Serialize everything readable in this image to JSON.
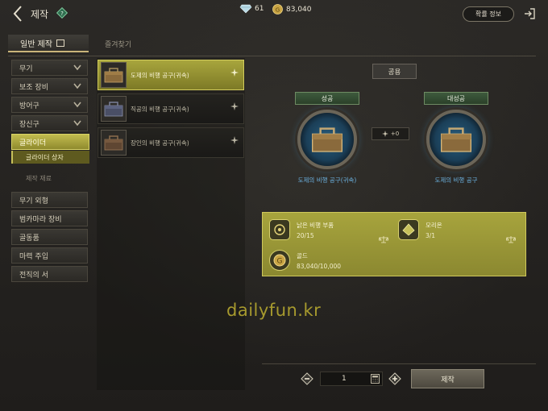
{
  "header": {
    "title": "제작",
    "crystal_count": "61",
    "gold_count": "83,040",
    "rate_info_label": "확률 정보"
  },
  "tabs": {
    "general": "일반 제작",
    "favorites": "즐겨찾기"
  },
  "categories": [
    {
      "label": "무기"
    },
    {
      "label": "보조 장비"
    },
    {
      "label": "방어구"
    },
    {
      "label": "장신구"
    }
  ],
  "active_category": "글라이더",
  "active_subcategory": "글라이더 상자",
  "section_label": "제작 재료",
  "sub_categories": [
    {
      "label": "무기 외형"
    },
    {
      "label": "범카마라 장비"
    },
    {
      "label": "골동품"
    },
    {
      "label": "마력 주입"
    },
    {
      "label": "전직의 서"
    }
  ],
  "items": [
    {
      "name": "도제의 비행 공구(귀속)",
      "selected": true
    },
    {
      "name": "직공의 비행 공구(귀속)",
      "selected": false
    },
    {
      "name": "장인의 비행 공구(귀속)",
      "selected": false
    }
  ],
  "detail": {
    "common_label": "공용",
    "success_label": "성공",
    "great_success_label": "대성공",
    "arrow_bonus": "+0",
    "success_result": "도제의 비행 공구(귀속)",
    "great_success_result": "도제의 비행 공구"
  },
  "materials": [
    {
      "name": "낡은 비행 부품",
      "count": "20/15"
    },
    {
      "name": "모리온",
      "count": "3/1"
    },
    {
      "name": "골드",
      "count": "83,040/10,000"
    }
  ],
  "watermark": "dailyfun.kr",
  "footer": {
    "quantity": "1",
    "craft_label": "제작"
  }
}
